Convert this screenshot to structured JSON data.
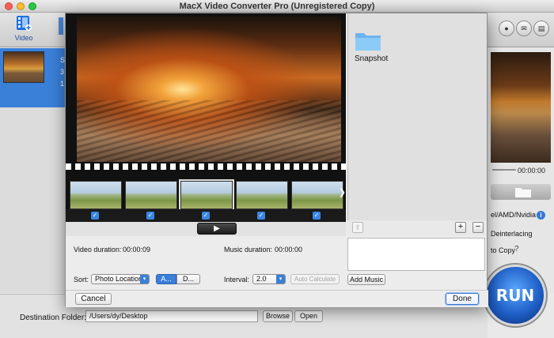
{
  "window": {
    "title": "MacX Video Converter Pro (Unregistered Copy)"
  },
  "toolbar": {
    "video_label": "Video"
  },
  "header_buttons": [
    "user-icon",
    "mail-icon",
    "cart-icon"
  ],
  "file_list": {
    "meta": [
      "S",
      "3",
      "1"
    ]
  },
  "right_panel": {
    "time": "00:00:00",
    "gpu_label": "el/AMD/Nvidia",
    "deinterlace_label": "Deinterlacing",
    "copy_label": "to Copy",
    "run_label": "RUN"
  },
  "destination": {
    "label": "Destination Folder:",
    "path": "/Users/dy/Desktop",
    "browse_label": "Browse",
    "open_label": "Open"
  },
  "dialog": {
    "snapshot_label": "Snapshot",
    "thumb_count": 5,
    "video_duration_label": "Video duration:",
    "video_duration": "00:00:09",
    "music_duration_label": "Music duration:",
    "music_duration": "00:00:00",
    "sort_label": "Sort:",
    "sort_value": "Photo Location",
    "seg_a": "A...",
    "seg_d": "D...",
    "interval_label": "Interval:",
    "interval_value": "2.0",
    "auto_calc_label": "Auto Calculate",
    "add_music_label": "Add Music",
    "cancel_label": "Cancel",
    "done_label": "Done"
  },
  "colors": {
    "accent": "#3a7fd8",
    "run": "#1f5fc6"
  }
}
